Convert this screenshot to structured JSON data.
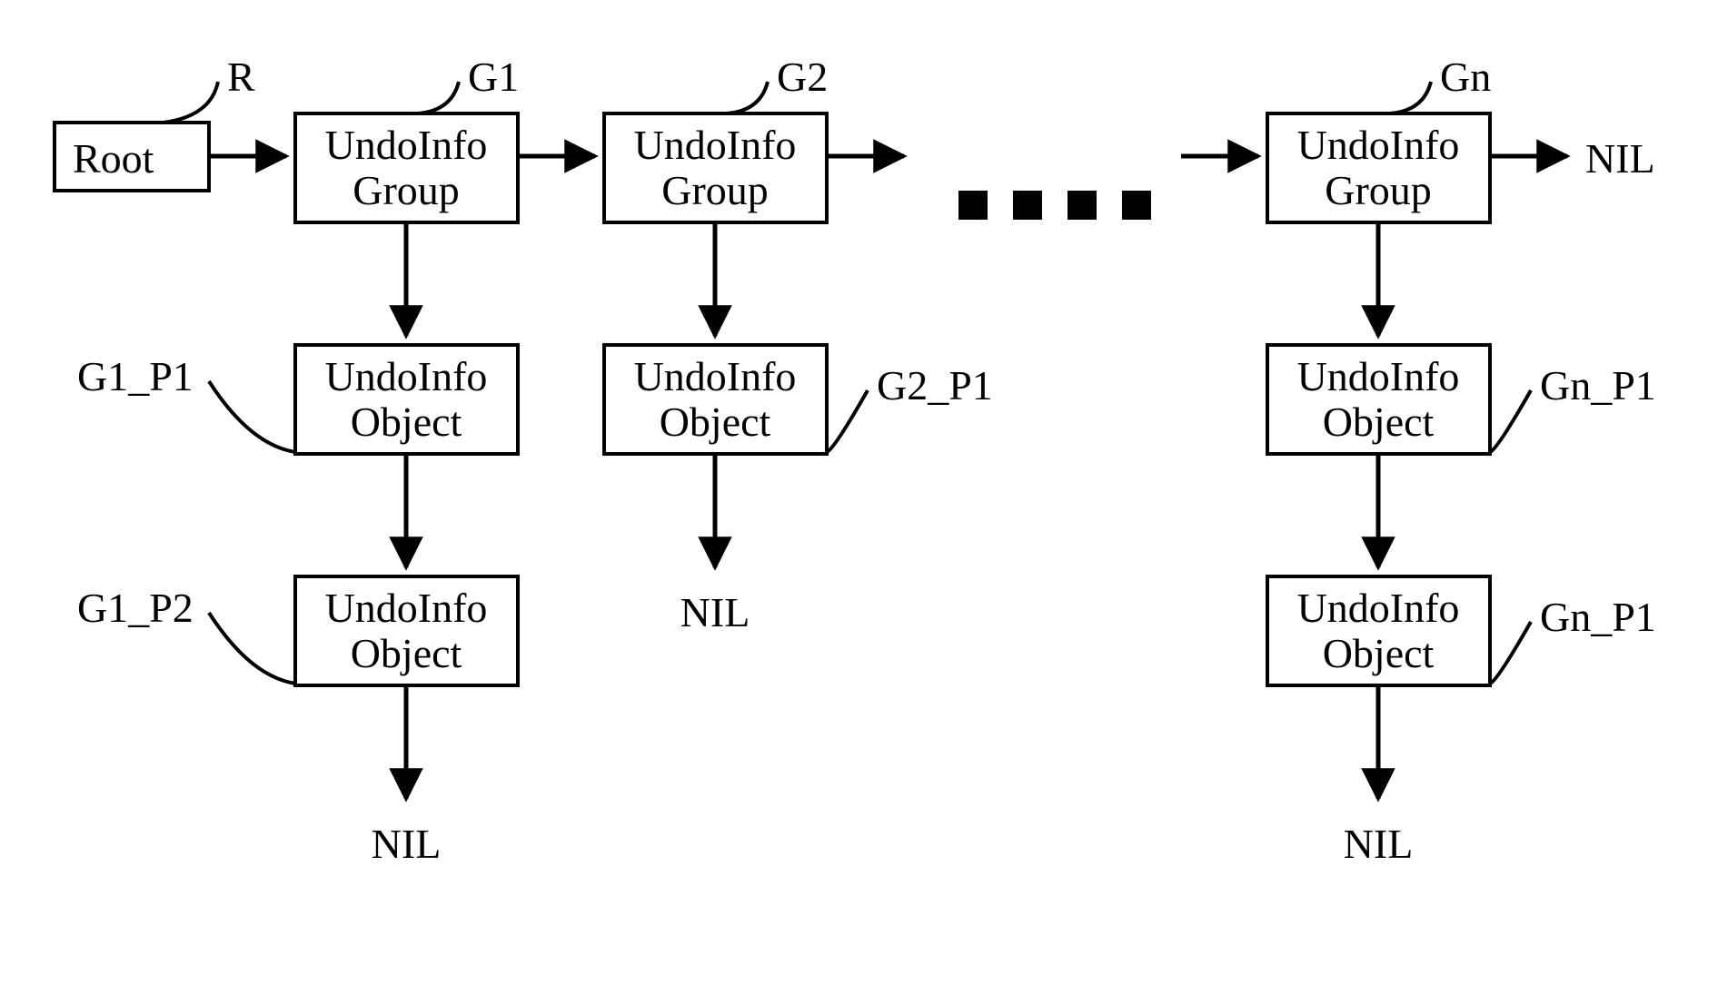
{
  "root": {
    "label": "Root",
    "tag": "R"
  },
  "groups": [
    {
      "tag": "G1",
      "label_line1": "UndoInfo",
      "label_line2": "Group",
      "children": [
        {
          "tag": "G1_P1",
          "label_line1": "UndoInfo",
          "label_line2": "Object"
        },
        {
          "tag": "G1_P2",
          "label_line1": "UndoInfo",
          "label_line2": "Object"
        }
      ],
      "terminal": "NIL"
    },
    {
      "tag": "G2",
      "label_line1": "UndoInfo",
      "label_line2": "Group",
      "children": [
        {
          "tag": "G2_P1",
          "label_line1": "UndoInfo",
          "label_line2": "Object"
        }
      ],
      "terminal": "NIL"
    },
    {
      "tag": "Gn",
      "label_line1": "UndoInfo",
      "label_line2": "Group",
      "children": [
        {
          "tag": "Gn_P1",
          "label_line1": "UndoInfo",
          "label_line2": "Object"
        },
        {
          "tag": "Gn_P1",
          "label_line1": "UndoInfo",
          "label_line2": "Object"
        }
      ],
      "terminal": "NIL"
    }
  ],
  "list_terminal": "NIL",
  "ellipsis": "…"
}
